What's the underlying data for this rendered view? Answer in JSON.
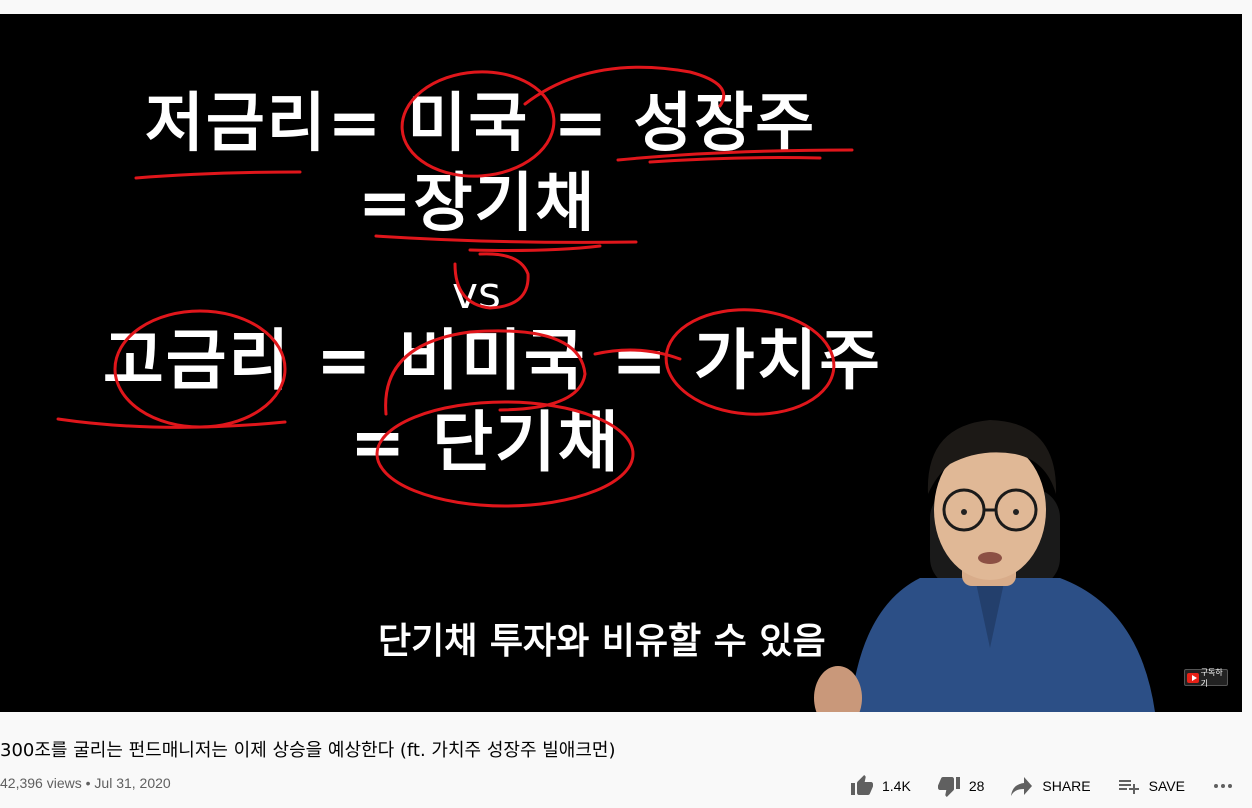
{
  "video": {
    "board_lines": {
      "line1": "저금리= 미국 = 성장주",
      "line2": "=장기채",
      "line3": "vs",
      "line4": "고금리 = 비미국 = 가치주",
      "line5": "= 단기채"
    },
    "caption": "단기채 투자와 비유할 수 있음",
    "subscribe_badge": "구독하기"
  },
  "info": {
    "title": "300조를 굴리는 펀드매니저는 이제 상승을 예상한다 (ft. 가치주 성장주 빌애크먼)",
    "views": "42,396 views",
    "separator": " • ",
    "date": "Jul 31, 2020"
  },
  "actions": {
    "like_count": "1.4K",
    "dislike_count": "28",
    "share_label": "SHARE",
    "save_label": "SAVE"
  },
  "icons": {
    "like": "thumbs-up-icon",
    "dislike": "thumbs-down-icon",
    "share": "share-arrow-icon",
    "save": "playlist-add-icon",
    "more": "more-horizontal-icon"
  },
  "colors": {
    "marker_red": "#e0161b",
    "player_bg": "#000000",
    "page_bg": "#f9f9f9",
    "shirt_blue": "#2c4f86"
  }
}
